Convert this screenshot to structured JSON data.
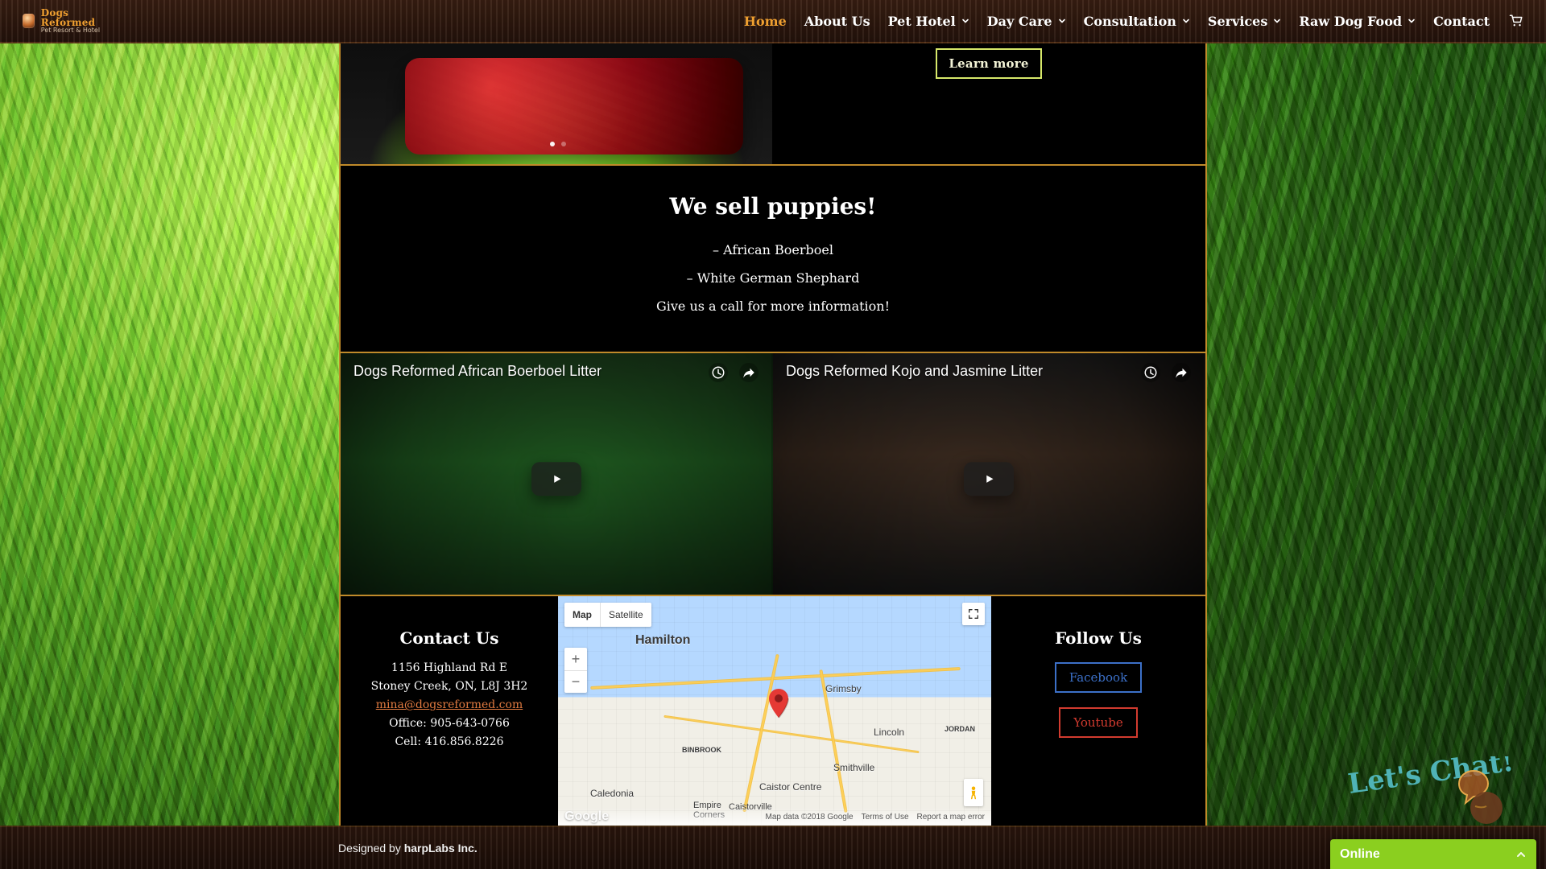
{
  "site": {
    "logo": {
      "title": "Dogs Reformed",
      "subtitle": "Pet Resort & Hotel"
    },
    "nav": {
      "items": [
        {
          "label": "Home",
          "active": true,
          "has_dropdown": false
        },
        {
          "label": "About Us",
          "active": false,
          "has_dropdown": false
        },
        {
          "label": "Pet Hotel",
          "active": false,
          "has_dropdown": true
        },
        {
          "label": "Day Care",
          "active": false,
          "has_dropdown": true
        },
        {
          "label": "Consultation",
          "active": false,
          "has_dropdown": true
        },
        {
          "label": "Services",
          "active": false,
          "has_dropdown": true
        },
        {
          "label": "Raw Dog Food",
          "active": false,
          "has_dropdown": true
        },
        {
          "label": "Contact",
          "active": false,
          "has_dropdown": false
        }
      ],
      "cart_icon": "shopping-cart-icon"
    }
  },
  "hero": {
    "learn_more_label": "Learn more",
    "slider": {
      "dots": [
        true,
        false
      ]
    }
  },
  "puppies": {
    "heading": "We sell puppies!",
    "breeds": [
      "– African Boerboel",
      "– White German Shephard"
    ],
    "cta": "Give us a call for more information!"
  },
  "videos": [
    {
      "title": "Dogs Reformed African Boerboel Litter",
      "actions": [
        "clock-icon",
        "share-icon"
      ]
    },
    {
      "title": "Dogs Reformed Kojo and Jasmine Litter",
      "actions": [
        "clock-icon",
        "share-icon"
      ]
    }
  ],
  "contact": {
    "heading": "Contact Us",
    "address_line1": "1156 Highland Rd E",
    "address_line2": "Stoney Creek, ON, L8J 3H2",
    "email": "mina@dogsreformed.com",
    "office": "Office: 905-643-0766",
    "cell": "Cell: 416.856.8226"
  },
  "map": {
    "tabs": [
      {
        "label": "Map",
        "active": true
      },
      {
        "label": "Satellite",
        "active": false
      }
    ],
    "zoom_in": "+",
    "zoom_out": "−",
    "labels": {
      "hamilton": "Hamilton",
      "grimsby": "Grimsby",
      "lincoln": "Lincoln",
      "jordan": "JORDAN",
      "binbrook": "BINBROOK",
      "smithville": "Smithville",
      "caledonia": "Caledonia",
      "caistor_centre": "Caistor Centre",
      "empire_corners": "Empire\nCorners",
      "caistorville": "Caistorville",
      "google": "Google"
    },
    "footer": {
      "data": "Map data ©2018 Google",
      "terms": "Terms of Use",
      "report": "Report a map error"
    }
  },
  "follow": {
    "heading": "Follow Us",
    "facebook": "Facebook",
    "youtube": "Youtube"
  },
  "footer": {
    "designed_by_prefix": "Designed by ",
    "designed_by_name": "harpLabs Inc."
  },
  "chat": {
    "status": "Online",
    "art_text": "Let's Chat!"
  },
  "colors": {
    "accent_orange": "#f0a030",
    "border_gold": "#c08a2a",
    "facebook_blue": "#3c70c8",
    "youtube_red": "#d23b2f",
    "chat_green": "#8bcf1f"
  }
}
